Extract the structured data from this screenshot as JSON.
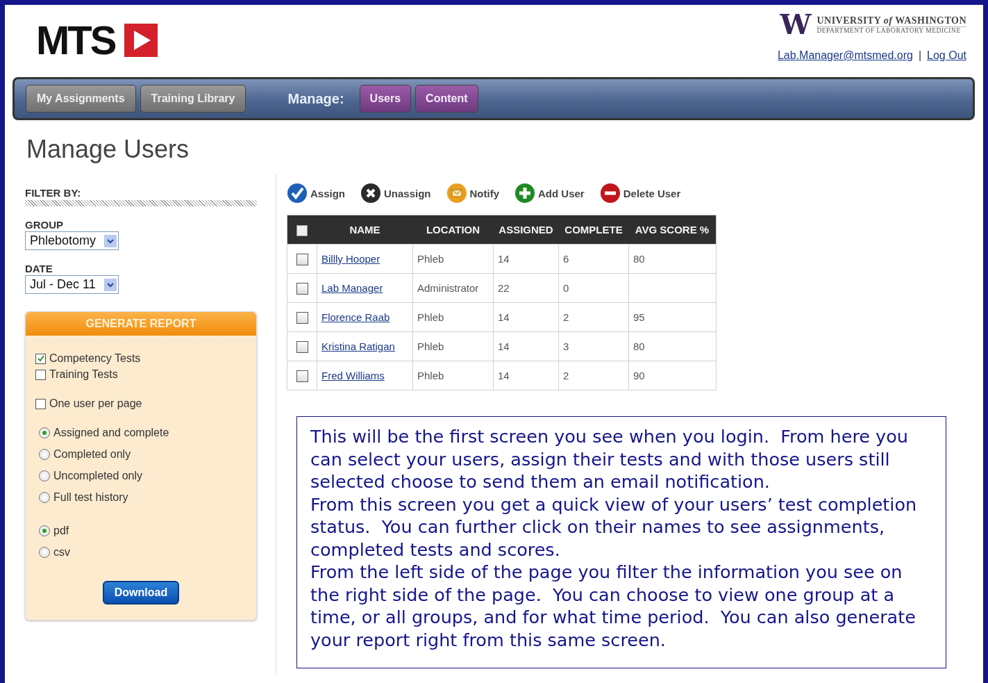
{
  "logo": {
    "text": "MTS"
  },
  "university": {
    "mark": "W",
    "name": "UNIVERSITY *of* WASHINGTON",
    "department": "DEPARTMENT OF LABORATORY MEDICINE"
  },
  "user_links": {
    "email": "Lab.Manager@mtsmed.org",
    "separator": "|",
    "logout": "Log Out"
  },
  "nav": {
    "tabs": [
      "My Assignments",
      "Training Library"
    ],
    "manage_label": "Manage:",
    "manage_tabs": [
      "Users",
      "Content"
    ]
  },
  "page_title": "Manage Users",
  "filter": {
    "heading": "FILTER BY:",
    "fields": [
      {
        "label": "GROUP",
        "value": "Phlebotomy"
      },
      {
        "label": "DATE",
        "value": "Jul - Dec 11"
      }
    ]
  },
  "report": {
    "title": "GENERATE REPORT",
    "test_options": [
      {
        "label": "Competency Tests",
        "checked": true
      },
      {
        "label": "Training Tests",
        "checked": false
      }
    ],
    "page_option": {
      "label": "One user per page",
      "checked": false
    },
    "scope_options": [
      {
        "label": "Assigned and complete",
        "selected": true
      },
      {
        "label": "Completed only",
        "selected": false
      },
      {
        "label": "Uncompleted only",
        "selected": false
      },
      {
        "label": "Full test history",
        "selected": false
      }
    ],
    "format_options": [
      {
        "label": "pdf",
        "selected": true
      },
      {
        "label": "csv",
        "selected": false
      }
    ],
    "button": "Download"
  },
  "toolbar": [
    {
      "label": "Assign",
      "kind": "assign"
    },
    {
      "label": "Unassign",
      "kind": "unassign"
    },
    {
      "label": "Notify",
      "kind": "notify"
    },
    {
      "label": "Add User",
      "kind": "add"
    },
    {
      "label": "Delete User",
      "kind": "delete"
    }
  ],
  "table": {
    "select_all_checked": false,
    "columns": [
      "NAME",
      "LOCATION",
      "ASSIGNED",
      "COMPLETE",
      "AVG SCORE %"
    ],
    "rows": [
      {
        "checked": false,
        "name": "Billly Hooper",
        "location": "Phleb",
        "assigned": "14",
        "complete": "6",
        "avg_score": "80"
      },
      {
        "checked": false,
        "name": "Lab Manager",
        "location": "Administrator",
        "assigned": "22",
        "complete": "0"
      },
      {
        "checked": false,
        "name": "Florence Raab",
        "location": "Phleb",
        "assigned": "14",
        "complete": "2",
        "avg_score": "95"
      },
      {
        "checked": false,
        "name": "Kristina Ratigan",
        "location": "Phleb",
        "assigned": "14",
        "complete": "3",
        "avg_score": "80"
      },
      {
        "checked": false,
        "name": "Fred Williams",
        "location": "Phleb",
        "assigned": "14",
        "complete": "2",
        "avg_score": "90"
      }
    ]
  },
  "note": {
    "paragraphs": [
      "This will be the first screen you see when you login.  From here you can select your users, assign their tests and with those users still selected choose to send them an email notification.",
      "From this screen you get a quick view of your users’ test completion status.  You can further click on their names to see assignments, completed tests and scores.",
      "From the left side of the page you filter the information you see on the right side of the page.  You can choose to view one group at a time, or all groups, and for what time period.  You can also generate your report right from this same screen."
    ]
  }
}
